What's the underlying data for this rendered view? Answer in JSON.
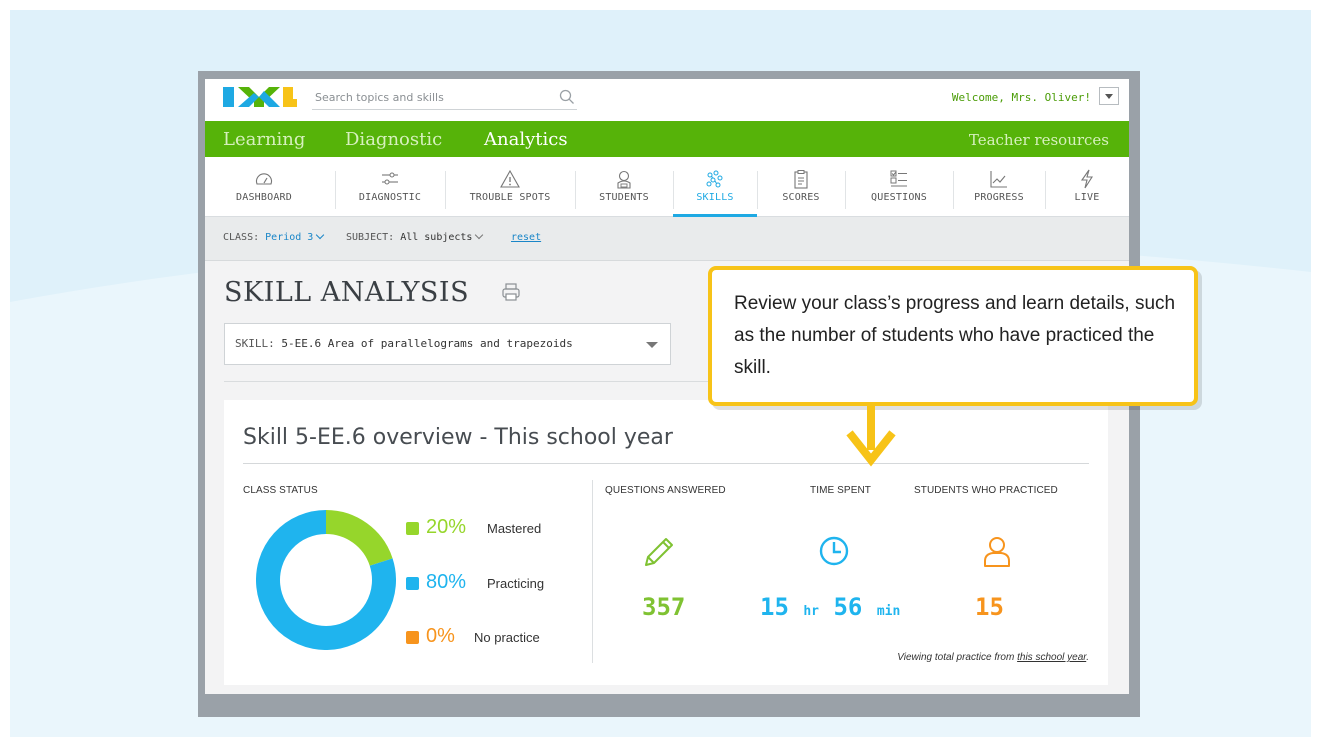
{
  "colors": {
    "brand_green": "#56b309",
    "brand_blue": "#1ea9e3",
    "mastered": "#96d62b",
    "practicing": "#1fb4ee",
    "no_practice": "#f7941d",
    "callout_border": "#f7c318"
  },
  "header": {
    "search_placeholder": "Search topics and skills",
    "welcome": "Welcome, Mrs. Oliver!"
  },
  "main_nav": {
    "items": [
      {
        "label": "Learning",
        "active": false
      },
      {
        "label": "Diagnostic",
        "active": false
      },
      {
        "label": "Analytics",
        "active": true
      }
    ],
    "right_link": "Teacher resources"
  },
  "sub_nav": {
    "items": [
      {
        "label": "DASHBOARD",
        "icon": "gauge-icon"
      },
      {
        "label": "DIAGNOSTIC",
        "icon": "sliders-icon"
      },
      {
        "label": "TROUBLE SPOTS",
        "icon": "warning-icon"
      },
      {
        "label": "STUDENTS",
        "icon": "student-icon"
      },
      {
        "label": "SKILLS",
        "icon": "skills-icon",
        "active": true
      },
      {
        "label": "SCORES",
        "icon": "clipboard-icon"
      },
      {
        "label": "QUESTIONS",
        "icon": "checklist-icon"
      },
      {
        "label": "PROGRESS",
        "icon": "chart-icon"
      },
      {
        "label": "LIVE",
        "icon": "lightning-icon"
      }
    ]
  },
  "filters": {
    "class_label": "CLASS:",
    "class_value": "Period 3",
    "subject_label": "SUBJECT:",
    "subject_value": "All subjects",
    "reset": "reset"
  },
  "page": {
    "title": "SKILL ANALYSIS",
    "skill_label": "SKILL:",
    "skill_value": "5-EE.6 Area of parallelograms and trapezoids"
  },
  "overview": {
    "title": "Skill 5-EE.6 overview - This school year",
    "class_status_label": "CLASS STATUS",
    "status": [
      {
        "pct": "20%",
        "label": "Mastered",
        "value": 20
      },
      {
        "pct": "80%",
        "label": "Practicing",
        "value": 80
      },
      {
        "pct": "0%",
        "label": "No practice",
        "value": 0
      }
    ],
    "stats": {
      "questions_label": "QUESTIONS ANSWERED",
      "questions_value": "357",
      "time_label": "TIME SPENT",
      "time_hours": "15",
      "time_hours_unit": "hr",
      "time_minutes": "56",
      "time_minutes_unit": "min",
      "students_label": "STUDENTS WHO PRACTICED",
      "students_value": "15"
    },
    "footnote_prefix": "Viewing total practice from ",
    "footnote_link": "this school year",
    "footnote_suffix": "."
  },
  "callout": {
    "text": "Review your class’s progress and learn details, such as the number of students who have practiced the skill."
  }
}
